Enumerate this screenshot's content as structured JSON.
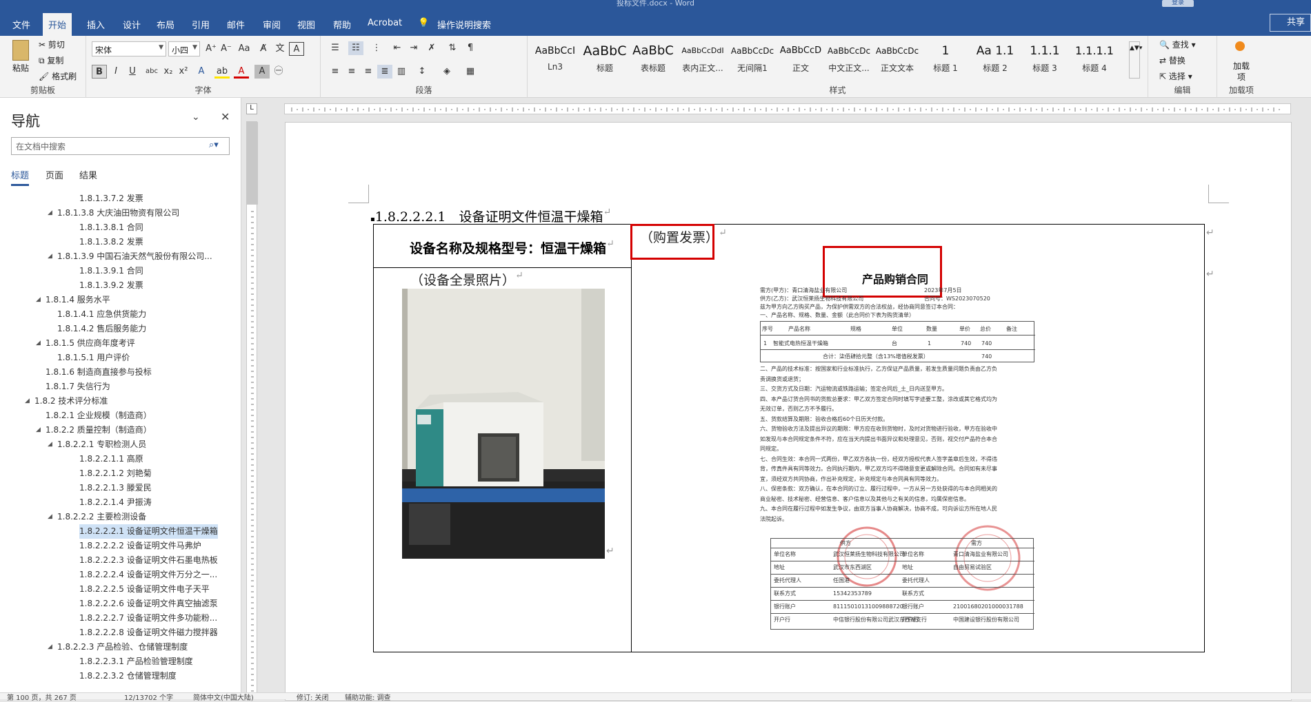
{
  "window": {
    "title": "投标文件.docx - Word",
    "login_label": "登录",
    "share_label": "共享"
  },
  "tabs": [
    "文件",
    "开始",
    "插入",
    "设计",
    "布局",
    "引用",
    "邮件",
    "审阅",
    "视图",
    "帮助",
    "Acrobat",
    "操作说明搜索"
  ],
  "ribbon": {
    "clipboard": {
      "paste": "粘贴",
      "cut": "剪切",
      "copy": "复制",
      "format_painter": "格式刷",
      "label": "剪贴板"
    },
    "font": {
      "font_name": "宋体",
      "font_size": "小四",
      "label": "字体"
    },
    "paragraph": {
      "label": "段落"
    },
    "styles": {
      "label": "样式",
      "items": [
        {
          "preview": "AaBbCcI",
          "name": "Ln3"
        },
        {
          "preview": "AaBbC",
          "name": "标题"
        },
        {
          "preview": "AaBbC",
          "name": "表标题"
        },
        {
          "preview": "AaBbCcDdI",
          "name": "表内正文..."
        },
        {
          "preview": "AaBbCcDc",
          "name": "无间隔1"
        },
        {
          "preview": "AaBbCcD",
          "name": "正文"
        },
        {
          "preview": "AaBbCcDc",
          "name": "中文正文..."
        },
        {
          "preview": "AaBbCcDc",
          "name": "正文文本"
        },
        {
          "preview": "1",
          "name": "标题 1"
        },
        {
          "preview": "Aa 1.1",
          "name": "标题 2"
        },
        {
          "preview": "1.1.1",
          "name": "标题 3"
        },
        {
          "preview": "1.1.1.1",
          "name": "标题 4"
        }
      ]
    },
    "editing": {
      "find": "查找",
      "replace": "替换",
      "select": "选择",
      "label": "编辑"
    },
    "addins": {
      "load": "加载项",
      "label": "加载项"
    }
  },
  "nav": {
    "title": "导航",
    "search_placeholder": "在文档中搜索",
    "tabs": [
      "标题",
      "页面",
      "结果"
    ],
    "items": [
      {
        "text": "1.8.1.3.7.2 发票",
        "level": 5,
        "caret": false,
        "selected": false
      },
      {
        "text": "1.8.1.3.8 大庆油田物资有限公司",
        "level": 4,
        "caret": true,
        "selected": false
      },
      {
        "text": "1.8.1.3.8.1 合同",
        "level": 5,
        "caret": false,
        "selected": false
      },
      {
        "text": "1.8.1.3.8.2 发票",
        "level": 5,
        "caret": false,
        "selected": false
      },
      {
        "text": "1.8.1.3.9 中国石油天然气股份有限公司...",
        "level": 4,
        "caret": true,
        "selected": false
      },
      {
        "text": "1.8.1.3.9.1 合同",
        "level": 5,
        "caret": false,
        "selected": false
      },
      {
        "text": "1.8.1.3.9.2 发票",
        "level": 5,
        "caret": false,
        "selected": false
      },
      {
        "text": "1.8.1.4 服务水平",
        "level": 3,
        "caret": true,
        "selected": false
      },
      {
        "text": "1.8.1.4.1 应急供货能力",
        "level": 4,
        "caret": false,
        "selected": false
      },
      {
        "text": "1.8.1.4.2 售后服务能力",
        "level": 4,
        "caret": false,
        "selected": false
      },
      {
        "text": "1.8.1.5 供应商年度考评",
        "level": 3,
        "caret": true,
        "selected": false
      },
      {
        "text": "1.8.1.5.1 用户评价",
        "level": 4,
        "caret": false,
        "selected": false
      },
      {
        "text": "1.8.1.6 制造商直接参与投标",
        "level": 3,
        "caret": false,
        "selected": false
      },
      {
        "text": "1.8.1.7 失信行为",
        "level": 3,
        "caret": false,
        "selected": false
      },
      {
        "text": "1.8.2 技术评分标准",
        "level": 2,
        "caret": true,
        "selected": false
      },
      {
        "text": "1.8.2.1 企业规模（制造商）",
        "level": 3,
        "caret": false,
        "selected": false
      },
      {
        "text": "1.8.2.2 质量控制（制造商）",
        "level": 3,
        "caret": true,
        "selected": false
      },
      {
        "text": "1.8.2.2.1 专职检测人员",
        "level": 4,
        "caret": true,
        "selected": false
      },
      {
        "text": "1.8.2.2.1.1 高原",
        "level": 5,
        "caret": false,
        "selected": false
      },
      {
        "text": "1.8.2.2.1.2 刘艳菊",
        "level": 5,
        "caret": false,
        "selected": false
      },
      {
        "text": "1.8.2.2.1.3 滕爱民",
        "level": 5,
        "caret": false,
        "selected": false
      },
      {
        "text": "1.8.2.2.1.4 尹振涛",
        "level": 5,
        "caret": false,
        "selected": false
      },
      {
        "text": "1.8.2.2.2 主要检测设备",
        "level": 4,
        "caret": true,
        "selected": false
      },
      {
        "text": "1.8.2.2.2.1 设备证明文件恒温干燥箱",
        "level": 5,
        "caret": false,
        "selected": true
      },
      {
        "text": "1.8.2.2.2.2 设备证明文件马弗炉",
        "level": 5,
        "caret": false,
        "selected": false
      },
      {
        "text": "1.8.2.2.2.3 设备证明文件石墨电热板",
        "level": 5,
        "caret": false,
        "selected": false
      },
      {
        "text": "1.8.2.2.2.4 设备证明文件万分之一...",
        "level": 5,
        "caret": false,
        "selected": false
      },
      {
        "text": "1.8.2.2.2.5 设备证明文件电子天平",
        "level": 5,
        "caret": false,
        "selected": false
      },
      {
        "text": "1.8.2.2.2.6 设备证明文件真空抽滤泵",
        "level": 5,
        "caret": false,
        "selected": false
      },
      {
        "text": "1.8.2.2.2.7 设备证明文件多功能粉...",
        "level": 5,
        "caret": false,
        "selected": false
      },
      {
        "text": "1.8.2.2.2.8 设备证明文件磁力搅拌器",
        "level": 5,
        "caret": false,
        "selected": false
      },
      {
        "text": "1.8.2.2.3 产品检验、仓储管理制度",
        "level": 4,
        "caret": true,
        "selected": false
      },
      {
        "text": "1.8.2.2.3.1 产品检验管理制度",
        "level": 5,
        "caret": false,
        "selected": false
      },
      {
        "text": "1.8.2.2.3.2 仓储管理制度",
        "level": 5,
        "caret": false,
        "selected": false
      }
    ]
  },
  "document": {
    "heading": "1.8.2.2.2.1　设备证明文件恒温干燥箱",
    "cell_header": "设备名称及规格型号：恒温干燥箱",
    "photo_caption": "（设备全景照片）",
    "invoice_caption": "（购置发票）",
    "contract": {
      "title": "产品购销合同",
      "buyer": "需方(甲方)：青口清海盐业有限公司",
      "date": "2023年7月5日",
      "seller": "供方(乙方)：武汉恒莱扬生物科技有限公司",
      "contract_no": "合同号：WS2023070520",
      "intro": "兹为甲方向乙方购买产品，为保护供需双方的合法权益，经协商同意签订本合同：",
      "section1": "一、产品名称、规格、数量、金额（此合同价下表为购货清单）",
      "table_headers": [
        "序号",
        "产品名称",
        "规格",
        "单位",
        "数量",
        "单价",
        "总价",
        "备注"
      ],
      "table_row": [
        "1",
        "智能式电热恒温干燥箱",
        "",
        "台",
        "1",
        "740",
        "740",
        ""
      ],
      "total_label": "合计：柒佰肆拾元整（含13%增值税发票）",
      "total_value": "740",
      "clauses": [
        "二、产品的技术标准：按国家和行业标准执行，乙方保证产品质量，若发生质量问题负责由乙方负",
        "责调换货或退货；",
        "三、交货方式及日期：汽运物流或铁路运输；签定合同后_土_日内送至甲方。",
        "四、本产品订货合同书的货款总要求：甲乙双方签定合同时填写字迹要工整，涂改或其它格式均为",
        "无效订单，否则乙方不予履行。",
        "五、货款结算及期限：验收合格后60个日历天付款。",
        "六、货物验收方法及提出异议的期限：甲方应在收到货物时，及时对货物进行验收，甲方在验收中",
        "如发现与本合同规定条件不符，应在当天内提出书面异议和处理意见，否则，视交付产品符合本合",
        "同规定。",
        "七、合同生效：本合同一式两份，甲乙双方各执一份，经双方授权代表人签字盖章后生效，不得违",
        "背，传真件具有同等效力。合同执行期内，甲乙双方均不得随意变更或解除合同。合同如有未尽事",
        "宜，须经双方共同协商，作出补充规定，补充规定与本合同具有同等效力。",
        "八、保密条款：双方确认，在本合同的订立、履行过程中，一方从另一方处获得的与本合同相关的",
        "商业秘密、技术秘密、经营信息、客户信息以及其他与之有关的信息，均属保密信息。",
        "九、本合同在履行过程中如发生争议，由双方当事人协商解决，协商不成，可向诉讼方所在地人民",
        "法院起诉。"
      ],
      "sign_headers": [
        "供方",
        "需方"
      ],
      "sign_rows": [
        [
          "单位名称",
          "武汉恒莱扬生物科技有限公司",
          "单位名称",
          "青口清海盐业有限公司"
        ],
        [
          "地址",
          "武汉市东西湖区",
          "地址",
          "自由贸易试验区"
        ],
        [
          "委托代理人",
          "任国港",
          "委托代理人",
          ""
        ],
        [
          "联系方式",
          "15342353789",
          "联系方式",
          ""
        ],
        [
          "银行账户",
          "81115010131009888720",
          "银行账户",
          "21001680201000031788"
        ],
        [
          "开户行",
          "中信银行股份有限公司武汉东西湖支行",
          "开户行",
          "中国建设银行股份有限公司"
        ]
      ]
    }
  },
  "status": {
    "page": "第 100 页，共 267 页",
    "words": "12/13702 个字",
    "lang": "简体中文(中国大陆)",
    "track": "修订: 关闭",
    "access": "辅助功能: 调查"
  }
}
